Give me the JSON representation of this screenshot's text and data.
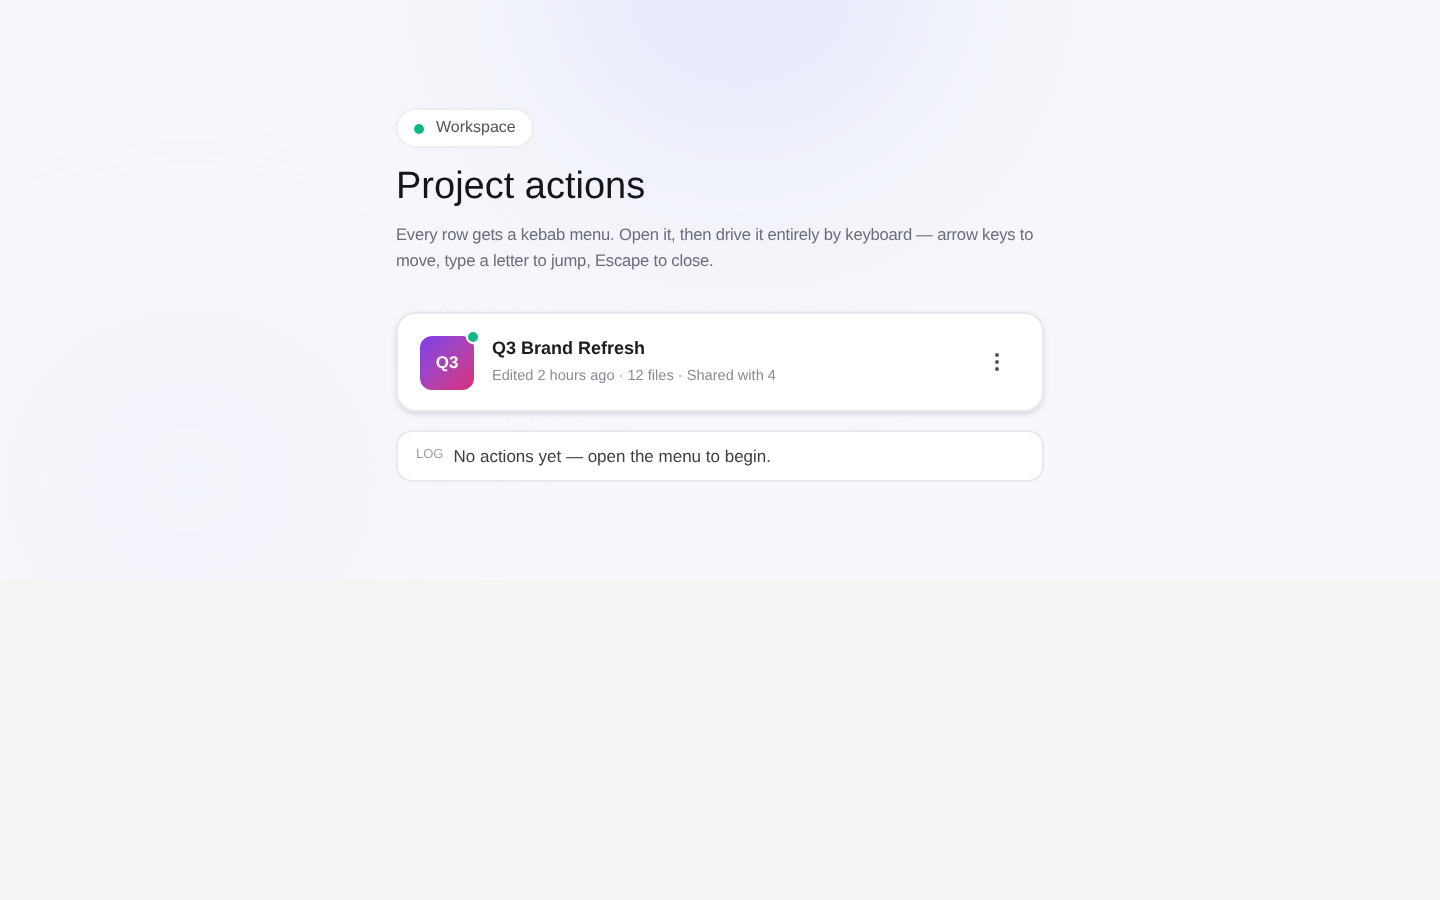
{
  "badge": {
    "label": "Workspace"
  },
  "title": "Project actions",
  "description": "Every row gets a kebab menu. Open it, then drive it entirely by keyboard — arrow keys to move, type a letter to jump, Escape to close.",
  "projects": [
    {
      "initials": "Q3",
      "name": "Q3 Brand Refresh",
      "meta": "Edited 2 hours ago · 12 files · Shared with 4",
      "online": true
    }
  ],
  "log": {
    "tag": "LOG",
    "message": "No actions yet — open the menu to begin."
  }
}
